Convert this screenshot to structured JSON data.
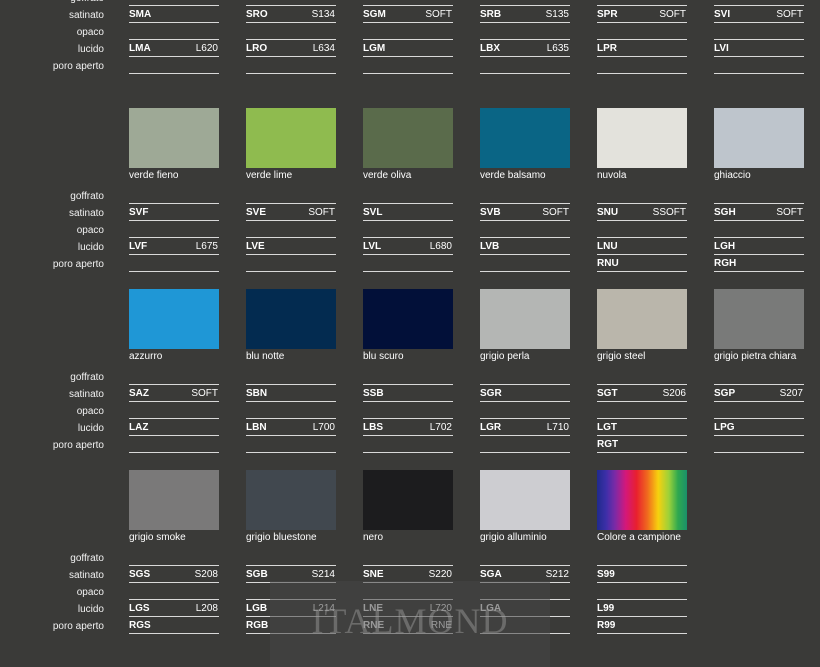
{
  "row_labels": [
    "goffrato",
    "satinato",
    "opaco",
    "lucido",
    "poro aperto"
  ],
  "watermark": "ITALMOND",
  "groups": [
    {
      "show_swatches": false,
      "items": [
        {
          "name": "",
          "color": "",
          "satinato": {
            "code": "SMA",
            "note": ""
          },
          "lucido": {
            "code": "LMA",
            "note": "L620"
          },
          "poro": ""
        },
        {
          "name": "",
          "color": "",
          "satinato": {
            "code": "SRO",
            "note": "S134"
          },
          "lucido": {
            "code": "LRO",
            "note": "L634"
          },
          "poro": ""
        },
        {
          "name": "",
          "color": "",
          "satinato": {
            "code": "SGM",
            "note": "SOFT"
          },
          "lucido": {
            "code": "LGM",
            "note": ""
          },
          "poro": ""
        },
        {
          "name": "",
          "color": "",
          "satinato": {
            "code": "SRB",
            "note": "S135"
          },
          "lucido": {
            "code": "LBX",
            "note": "L635"
          },
          "poro": ""
        },
        {
          "name": "",
          "color": "",
          "satinato": {
            "code": "SPR",
            "note": "SOFT"
          },
          "lucido": {
            "code": "LPR",
            "note": ""
          },
          "poro": ""
        },
        {
          "name": "",
          "color": "",
          "satinato": {
            "code": "SVI",
            "note": "SOFT"
          },
          "lucido": {
            "code": "LVI",
            "note": ""
          },
          "poro": ""
        }
      ]
    },
    {
      "show_swatches": true,
      "items": [
        {
          "name": "verde fieno",
          "color": "#9ea996",
          "satinato": {
            "code": "SVF",
            "note": ""
          },
          "lucido": {
            "code": "LVF",
            "note": "L675"
          },
          "poro": ""
        },
        {
          "name": "verde lime",
          "color": "#8fbb4f",
          "satinato": {
            "code": "SVE",
            "note": "SOFT"
          },
          "lucido": {
            "code": "LVE",
            "note": ""
          },
          "poro": ""
        },
        {
          "name": "verde oliva",
          "color": "#5a6b4b",
          "satinato": {
            "code": "SVL",
            "note": ""
          },
          "lucido": {
            "code": "LVL",
            "note": "L680"
          },
          "poro": ""
        },
        {
          "name": "verde balsamo",
          "color": "#0a6585",
          "satinato": {
            "code": "SVB",
            "note": "SOFT"
          },
          "lucido": {
            "code": "LVB",
            "note": ""
          },
          "poro": ""
        },
        {
          "name": "nuvola",
          "color": "#e3e2dc",
          "satinato": {
            "code": "SNU",
            "note": "SSOFT"
          },
          "lucido": {
            "code": "LNU",
            "note": ""
          },
          "poro": "RNU"
        },
        {
          "name": "ghiaccio",
          "color": "#bec5cc",
          "satinato": {
            "code": "SGH",
            "note": "SOFT"
          },
          "lucido": {
            "code": "LGH",
            "note": ""
          },
          "poro": "RGH"
        }
      ]
    },
    {
      "show_swatches": true,
      "items": [
        {
          "name": "azzurro",
          "color": "#1f97d6",
          "satinato": {
            "code": "SAZ",
            "note": "SOFT"
          },
          "lucido": {
            "code": "LAZ",
            "note": ""
          },
          "poro": ""
        },
        {
          "name": "blu notte",
          "color": "#032b50",
          "satinato": {
            "code": "SBN",
            "note": ""
          },
          "lucido": {
            "code": "LBN",
            "note": "L700"
          },
          "poro": ""
        },
        {
          "name": "blu scuro",
          "color": "#021039",
          "satinato": {
            "code": "SSB",
            "note": ""
          },
          "lucido": {
            "code": "LBS",
            "note": "L702"
          },
          "poro": ""
        },
        {
          "name": "grigio perla",
          "color": "#b4b6b4",
          "satinato": {
            "code": "SGR",
            "note": ""
          },
          "lucido": {
            "code": "LGR",
            "note": "L710"
          },
          "poro": ""
        },
        {
          "name": "grigio steel",
          "color": "#bab6ab",
          "satinato": {
            "code": "SGT",
            "note": "S206"
          },
          "lucido": {
            "code": "LGT",
            "note": ""
          },
          "poro": "RGT"
        },
        {
          "name": "grigio pietra chiara",
          "color": "#797a79",
          "satinato": {
            "code": "SGP",
            "note": "S207"
          },
          "lucido": {
            "code": "LPG",
            "note": ""
          },
          "poro": ""
        }
      ]
    },
    {
      "show_swatches": true,
      "items": [
        {
          "name": "grigio smoke",
          "color": "#7a7979",
          "satinato": {
            "code": "SGS",
            "note": "S208"
          },
          "lucido": {
            "code": "LGS",
            "note": "L208"
          },
          "poro": "RGS"
        },
        {
          "name": "grigio bluestone",
          "color": "#41484f",
          "satinato": {
            "code": "SGB",
            "note": "S214"
          },
          "lucido": {
            "code": "LGB",
            "note": "L214"
          },
          "poro": "RGB"
        },
        {
          "name": "nero",
          "color": "#1c1c1e",
          "satinato": {
            "code": "SNE",
            "note": "S220"
          },
          "lucido": {
            "code": "LNE",
            "note": "L720"
          },
          "poro": "RNE",
          "poro_note": "RNE"
        },
        {
          "name": "grigio alluminio",
          "color": "#cdcdd1",
          "satinato": {
            "code": "SGA",
            "note": "S212"
          },
          "lucido": {
            "code": "LGA",
            "note": ""
          },
          "poro": ""
        },
        {
          "name": "Colore a campione",
          "color": "rainbow",
          "satinato": {
            "code": "S99",
            "note": ""
          },
          "lucido": {
            "code": "L99",
            "note": ""
          },
          "poro": "R99"
        }
      ]
    }
  ]
}
